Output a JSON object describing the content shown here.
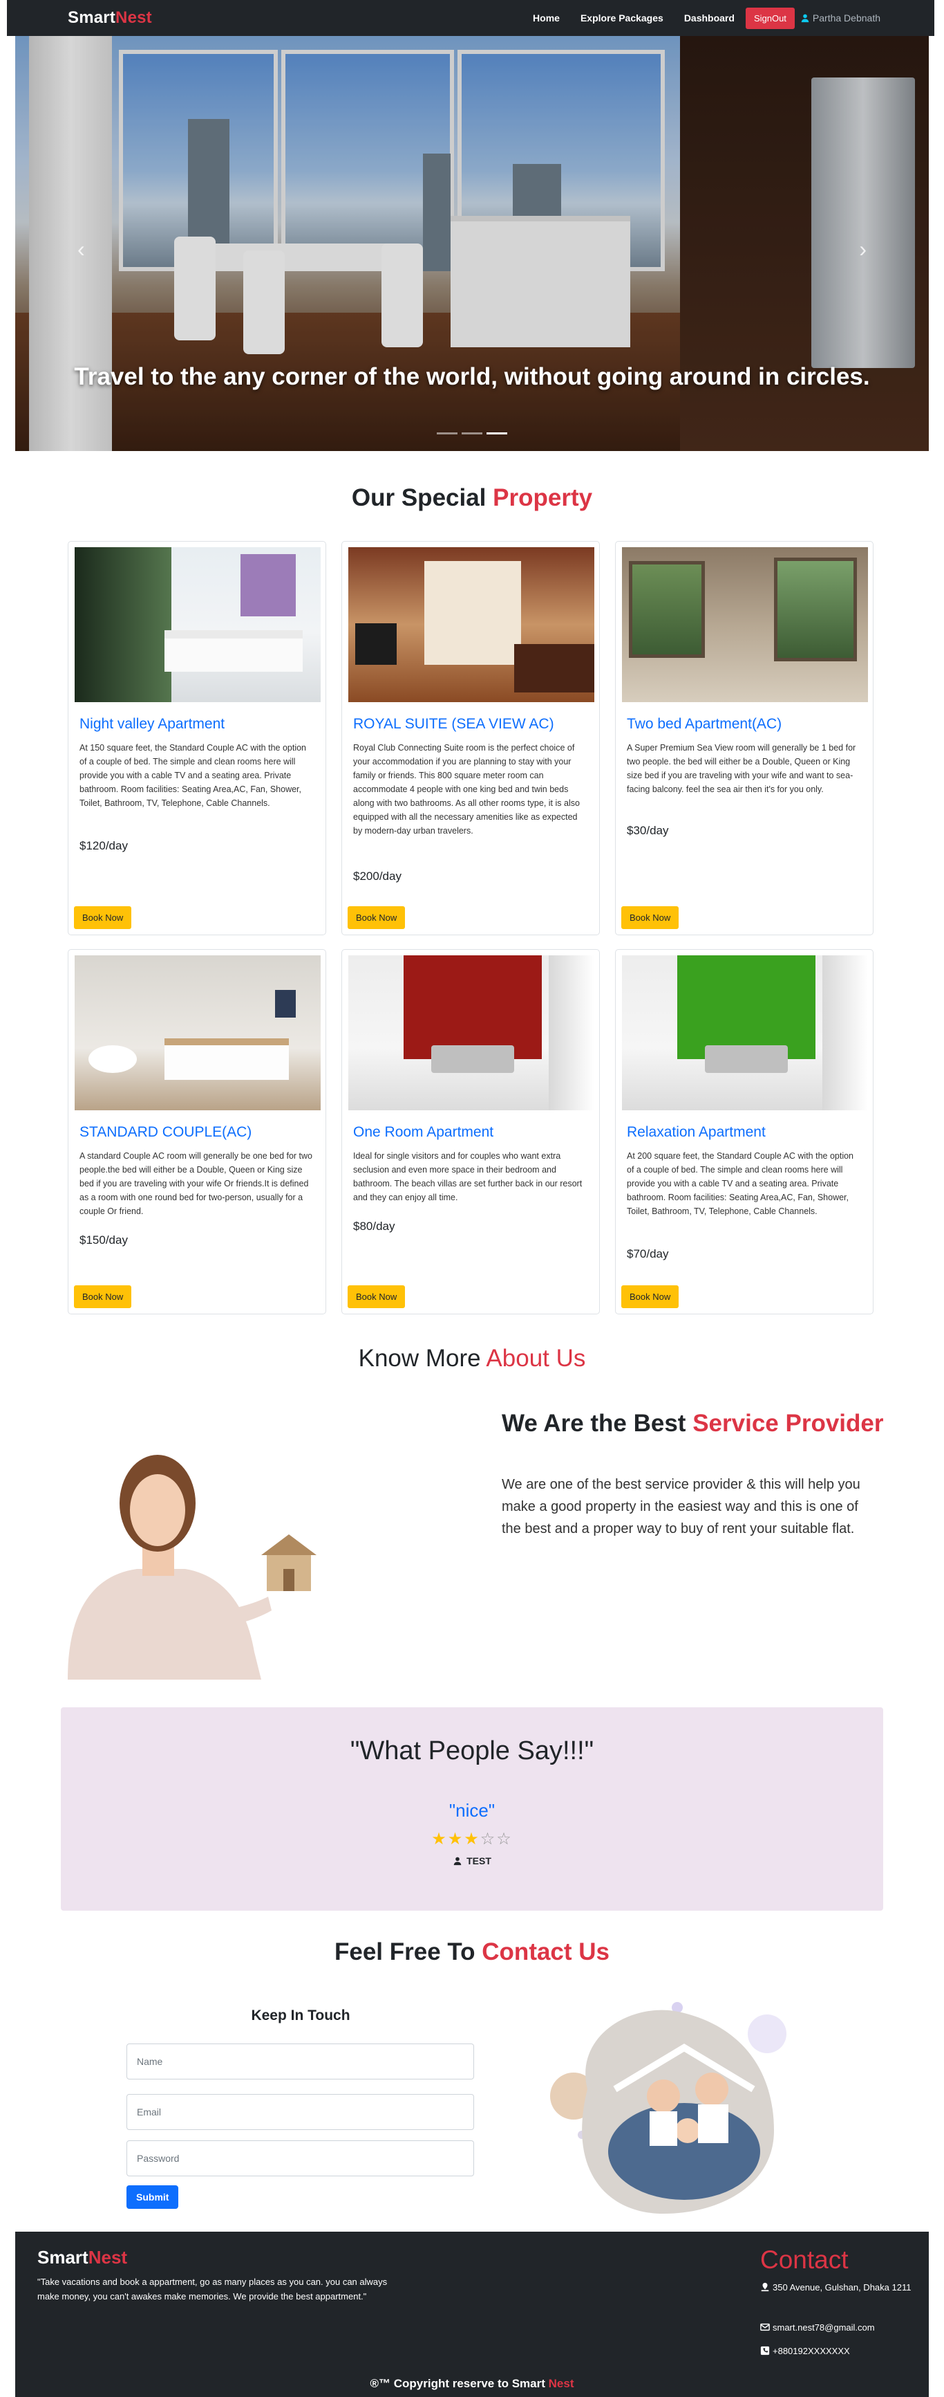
{
  "navbar": {
    "brand_main": "Smart",
    "brand_accent": "Nest",
    "links": [
      "Home",
      "Explore Packages",
      "Dashboard"
    ],
    "signout_label": "SignOut",
    "user_name": "Partha Debnath"
  },
  "hero": {
    "caption": "Travel to the any corner of the world, without going around in circles.",
    "prev_icon": "chevron-left-icon",
    "next_icon": "chevron-right-icon",
    "slides": 3,
    "active_slide": 3
  },
  "properties_section": {
    "title_main": "Our Special",
    "title_accent": "Property"
  },
  "properties": [
    {
      "name": "Night valley Apartment",
      "description": "At 150 square feet, the Standard Couple AC with the option of a couple of bed. The simple and clean rooms here will provide you with a cable TV and a seating area. Private bathroom. Room facilities: Seating Area,AC, Fan, Shower, Toilet, Bathroom, TV, Telephone, Cable Channels.",
      "price": "$120/day",
      "button": "Book Now"
    },
    {
      "name": "ROYAL SUITE (SEA VIEW AC)",
      "description": "Royal Club Connecting Suite room is the perfect choice of your accommodation if you are planning to stay with your family or friends. This 800 square meter room can accommodate 4 people with one king bed and twin beds along with two bathrooms. As all other rooms type, it is also equipped with all the necessary amenities like as expected by modern-day urban travelers.",
      "price": "$200/day",
      "button": "Book Now"
    },
    {
      "name": "Two bed Apartment(AC)",
      "description": "A Super Premium Sea View room will generally be 1 bed for two people. the bed will either be a Double, Queen or King size bed if you are traveling with your wife and want to sea-facing balcony. feel the sea air then it's for you only.",
      "price": "$30/day",
      "button": "Book Now"
    },
    {
      "name": "STANDARD COUPLE(AC)",
      "description": "A standard Couple AC room will generally be one bed for two people.the bed will either be a Double, Queen or King size bed if you are traveling with your wife Or friends.It is defined as a room with one round bed for two-person, usually for a couple Or friend.",
      "price": "$150/day",
      "button": "Book Now"
    },
    {
      "name": "One Room Apartment",
      "description": "Ideal for single visitors and for couples who want extra seclusion and even more space in their bedroom and bathroom. The beach villas are set further back in our resort and they can enjoy all time.",
      "price": "$80/day",
      "button": "Book Now"
    },
    {
      "name": "Relaxation Apartment",
      "description": "At 200 square feet, the Standard Couple AC with the option of a couple of bed. The simple and clean rooms here will provide you with a cable TV and a seating area. Private bathroom. Room facilities: Seating Area,AC, Fan, Shower, Toilet, Bathroom, TV, Telephone, Cable Channels.",
      "price": "$70/day",
      "button": "Book Now"
    }
  ],
  "about": {
    "title_main": "Know More",
    "title_accent": "About Us",
    "heading_main": "We Are the Best",
    "heading_accent": "Service Provider",
    "text": "We are one of the best service provider & this will help you make a good property in the easiest way and this is one of the best and a proper way to buy of rent your suitable flat."
  },
  "testimonial": {
    "heading": "\"What People Say!!!\"",
    "quote": "\"nice\"",
    "rating": 3,
    "rating_max": 5,
    "user": "TEST"
  },
  "contact": {
    "title_main": "Feel Free To",
    "title_accent": "Contact Us",
    "form_title": "Keep In Touch",
    "name_placeholder": "Name",
    "email_placeholder": "Email",
    "password_placeholder": "Password",
    "submit_label": "Submit"
  },
  "footer": {
    "brand_main": "Smart",
    "brand_accent": "Nest",
    "text": "\"Take vacations and book a appartment, go as many places as you can. you can always make money, you can't awakes make memories. We provide the best appartment.\"",
    "contact_title": "Contact",
    "address": "350 Avenue, Gulshan, Dhaka 1211",
    "email": "smart.nest78@gmail.com",
    "phone": "+880192XXXXXXX",
    "copyright_main": "®™ Copyright reserve to Smart",
    "copyright_accent": "Nest"
  },
  "colors": {
    "accent": "#dc3545",
    "primary": "#0d6efd",
    "warning": "#ffc107",
    "dark": "#212529"
  }
}
